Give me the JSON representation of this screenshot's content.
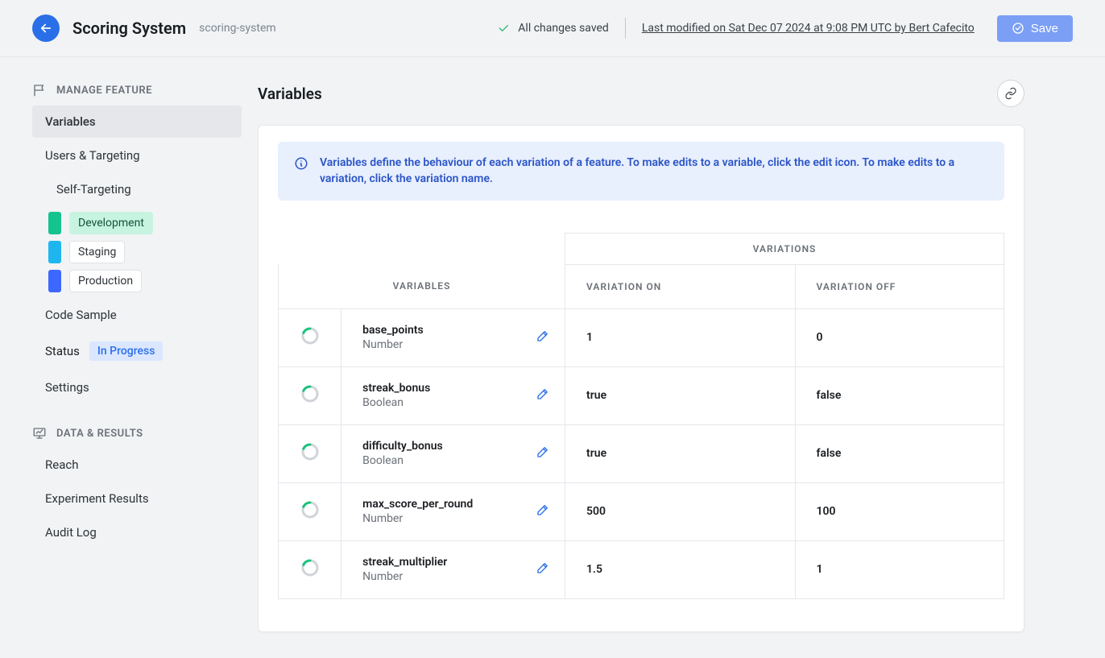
{
  "header": {
    "featureTitle": "Scoring System",
    "featureSlug": "scoring-system",
    "savedStatus": "All changes saved",
    "lastModified": "Last modified on Sat Dec 07 2024 at 9:08 PM UTC by Bert Cafecito",
    "saveLabel": "Save"
  },
  "sidebar": {
    "section1Label": "MANAGE FEATURE",
    "variables": "Variables",
    "usersTargeting": "Users & Targeting",
    "selfTargeting": "Self-Targeting",
    "envs": {
      "development": {
        "label": "Development",
        "color": "#14c38e"
      },
      "staging": {
        "label": "Staging",
        "color": "#1fb6f0"
      },
      "production": {
        "label": "Production",
        "color": "#3d68ff"
      }
    },
    "codeSample": "Code Sample",
    "statusLabel": "Status",
    "statusValue": "In Progress",
    "settings": "Settings",
    "section2Label": "DATA & RESULTS",
    "reach": "Reach",
    "experimentResults": "Experiment Results",
    "auditLog": "Audit Log"
  },
  "panel": {
    "title": "Variables",
    "infoText": "Variables define the behaviour of each variation of a feature. To make edits to a variable, click the edit icon. To make edits to a variation, click the variation name."
  },
  "table": {
    "superHeader": "VARIATIONS",
    "colVariables": "VARIABLES",
    "colOn": "VARIATION ON",
    "colOff": "VARIATION OFF",
    "rows": [
      {
        "name": "base_points",
        "type": "Number",
        "on": "1",
        "off": "0"
      },
      {
        "name": "streak_bonus",
        "type": "Boolean",
        "on": "true",
        "off": "false"
      },
      {
        "name": "difficulty_bonus",
        "type": "Boolean",
        "on": "true",
        "off": "false"
      },
      {
        "name": "max_score_per_round",
        "type": "Number",
        "on": "500",
        "off": "100"
      },
      {
        "name": "streak_multiplier",
        "type": "Number",
        "on": "1.5",
        "off": "1"
      }
    ]
  }
}
